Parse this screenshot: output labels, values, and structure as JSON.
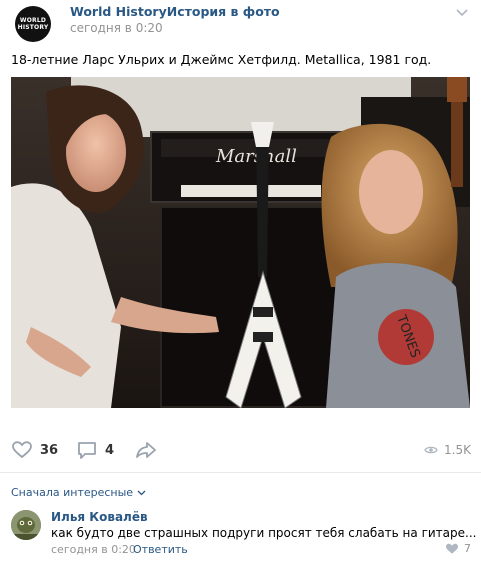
{
  "post": {
    "author": "World HistoryИстория в фото",
    "time": "сегодня в 0:20",
    "avatar_text_line1": "WORLD",
    "avatar_text_line2": "HISTORY",
    "text": "18-летние Ларс Ульрих и Джеймс Хетфилд. Metallica, 1981 год.",
    "photo_sign_text": "Marshall"
  },
  "actions": {
    "likes": "36",
    "comments": "4",
    "views": "1.5K"
  },
  "comments_section": {
    "sort_label": "Сначала интересные",
    "items": [
      {
        "author": "Илья Ковалёв",
        "text": "как будто две страшных подруги просят тебя слабать на гитаре...",
        "time": "сегодня в 0:20",
        "reply_label": "Ответить",
        "likes": "7"
      }
    ]
  },
  "colors": {
    "link": "#2a5885",
    "muted": "#939393",
    "separator": "#e7e8ec"
  },
  "icons": [
    "chevron-down-icon",
    "heart-icon",
    "comment-icon",
    "share-icon",
    "eye-icon"
  ]
}
